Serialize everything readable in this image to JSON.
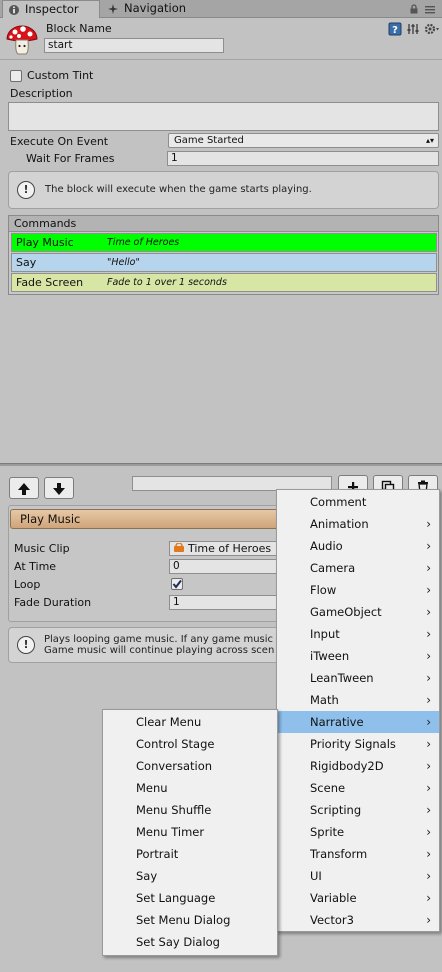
{
  "tabs": [
    {
      "label": "Inspector",
      "icon": "info-icon",
      "active": true
    },
    {
      "label": "Navigation",
      "icon": "compass-icon",
      "active": false
    }
  ],
  "header": {
    "block_name_label": "Block Name",
    "block_name_value": "start",
    "icons": [
      "help-book-icon",
      "sliders-icon",
      "gear-icon"
    ]
  },
  "fields": {
    "custom_tint_label": "Custom Tint",
    "custom_tint_checked": false,
    "description_label": "Description",
    "description_value": "",
    "execute_on_event_label": "Execute On Event",
    "execute_on_event_value": "Game Started",
    "wait_for_frames_label": "Wait For Frames",
    "wait_for_frames_value": "1"
  },
  "info_text": "The block will execute when the game starts playing.",
  "commands": {
    "header": "Commands",
    "rows": [
      {
        "name": "Play Music",
        "summary": "Time of Heroes",
        "color": "#00ff00"
      },
      {
        "name": "Say",
        "summary": "\"Hello\"",
        "color": "#b6d5ec"
      },
      {
        "name": "Fade Screen",
        "summary": "Fade to 1 over 1 seconds",
        "color": "#d7e6a5"
      }
    ]
  },
  "toolbar": {
    "up_icon": "arrow-up-icon",
    "down_icon": "arrow-down-icon",
    "search_value": "",
    "add_icon": "plus-icon",
    "duplicate_icon": "duplicate-icon",
    "delete_icon": "trash-icon"
  },
  "selected_command": {
    "title": "Play Music",
    "music_clip_label": "Music Clip",
    "music_clip_value": "Time of Heroes",
    "at_time_label": "At Time",
    "at_time_value": "0",
    "loop_label": "Loop",
    "loop_checked": true,
    "fade_duration_label": "Fade Duration",
    "fade_duration_value": "1",
    "help_line1": "Plays looping game music. If any game music",
    "help_line2": "Game music will continue playing across scen"
  },
  "main_menu": {
    "items": [
      {
        "label": "Comment",
        "submenu": false
      },
      {
        "label": "Animation",
        "submenu": true
      },
      {
        "label": "Audio",
        "submenu": true
      },
      {
        "label": "Camera",
        "submenu": true
      },
      {
        "label": "Flow",
        "submenu": true
      },
      {
        "label": "GameObject",
        "submenu": true
      },
      {
        "label": "Input",
        "submenu": true
      },
      {
        "label": "iTween",
        "submenu": true
      },
      {
        "label": "LeanTween",
        "submenu": true
      },
      {
        "label": "Math",
        "submenu": true
      },
      {
        "label": "Narrative",
        "submenu": true,
        "highlighted": true
      },
      {
        "label": "Priority Signals",
        "submenu": true
      },
      {
        "label": "Rigidbody2D",
        "submenu": true
      },
      {
        "label": "Scene",
        "submenu": true
      },
      {
        "label": "Scripting",
        "submenu": true
      },
      {
        "label": "Sprite",
        "submenu": true
      },
      {
        "label": "Transform",
        "submenu": true
      },
      {
        "label": "UI",
        "submenu": true
      },
      {
        "label": "Variable",
        "submenu": true
      },
      {
        "label": "Vector3",
        "submenu": true
      }
    ],
    "highlight_color": "#8fc0ec"
  },
  "narrative_menu": {
    "items": [
      "Clear Menu",
      "Control Stage",
      "Conversation",
      "Menu",
      "Menu Shuffle",
      "Menu Timer",
      "Portrait",
      "Say",
      "Set Language",
      "Set Menu Dialog",
      "Set Say Dialog"
    ]
  }
}
